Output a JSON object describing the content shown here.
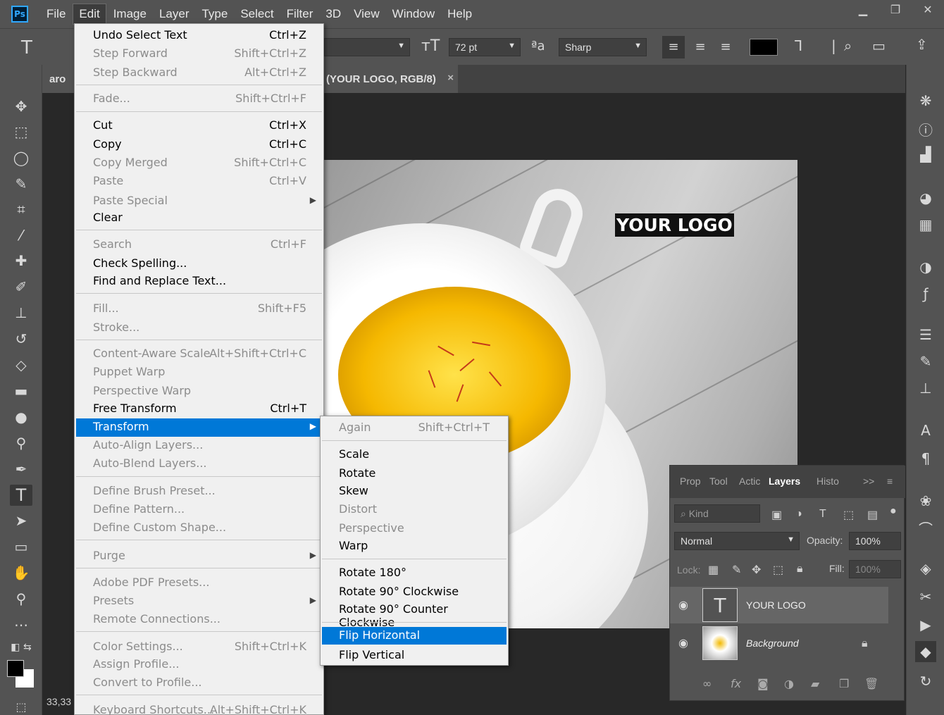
{
  "app": {
    "logo": "Ps"
  },
  "menubar": {
    "items": [
      "File",
      "Edit",
      "Image",
      "Layer",
      "Type",
      "Select",
      "Filter",
      "3D",
      "View",
      "Window",
      "Help"
    ]
  },
  "window_controls": {
    "minimize": "▁",
    "restore": "❐",
    "close": "✕"
  },
  "options": {
    "font_size": "72 pt",
    "antialias_icon_text": "ªa",
    "antialias": "Sharp",
    "text_color": "#000000"
  },
  "document": {
    "tab_left": "aro",
    "tab_active": "(YOUR LOGO, RGB/8)",
    "tab_close": "×",
    "logo_text": "YOUR LOGO"
  },
  "edit_menu": {
    "items": [
      {
        "label": "Undo Select Text",
        "shortcut": "Ctrl+Z",
        "disabled": false
      },
      {
        "label": "Step Forward",
        "shortcut": "Shift+Ctrl+Z",
        "disabled": true
      },
      {
        "label": "Step Backward",
        "shortcut": "Alt+Ctrl+Z",
        "disabled": true
      },
      {
        "label": "Fade...",
        "shortcut": "Shift+Ctrl+F",
        "disabled": true
      },
      {
        "label": "Cut",
        "shortcut": "Ctrl+X",
        "disabled": false
      },
      {
        "label": "Copy",
        "shortcut": "Ctrl+C",
        "disabled": false
      },
      {
        "label": "Copy Merged",
        "shortcut": "Shift+Ctrl+C",
        "disabled": true
      },
      {
        "label": "Paste",
        "shortcut": "Ctrl+V",
        "disabled": true
      },
      {
        "label": "Paste Special",
        "shortcut": "",
        "disabled": true
      },
      {
        "label": "Clear",
        "shortcut": "",
        "disabled": false
      },
      {
        "label": "Search",
        "shortcut": "Ctrl+F",
        "disabled": true
      },
      {
        "label": "Check Spelling...",
        "shortcut": "",
        "disabled": false
      },
      {
        "label": "Find and Replace Text...",
        "shortcut": "",
        "disabled": false
      },
      {
        "label": "Fill...",
        "shortcut": "Shift+F5",
        "disabled": true
      },
      {
        "label": "Stroke...",
        "shortcut": "",
        "disabled": true
      },
      {
        "label": "Content-Aware Scale",
        "shortcut": "Alt+Shift+Ctrl+C",
        "disabled": true
      },
      {
        "label": "Puppet Warp",
        "shortcut": "",
        "disabled": true
      },
      {
        "label": "Perspective Warp",
        "shortcut": "",
        "disabled": true
      },
      {
        "label": "Free Transform",
        "shortcut": "Ctrl+T",
        "disabled": false
      },
      {
        "label": "Transform",
        "shortcut": "",
        "disabled": false
      },
      {
        "label": "Auto-Align Layers...",
        "shortcut": "",
        "disabled": true
      },
      {
        "label": "Auto-Blend Layers...",
        "shortcut": "",
        "disabled": true
      },
      {
        "label": "Define Brush Preset...",
        "shortcut": "",
        "disabled": true
      },
      {
        "label": "Define Pattern...",
        "shortcut": "",
        "disabled": true
      },
      {
        "label": "Define Custom Shape...",
        "shortcut": "",
        "disabled": true
      },
      {
        "label": "Purge",
        "shortcut": "",
        "disabled": true
      },
      {
        "label": "Adobe PDF Presets...",
        "shortcut": "",
        "disabled": true
      },
      {
        "label": "Presets",
        "shortcut": "",
        "disabled": true
      },
      {
        "label": "Remote Connections...",
        "shortcut": "",
        "disabled": true
      },
      {
        "label": "Color Settings...",
        "shortcut": "Shift+Ctrl+K",
        "disabled": true
      },
      {
        "label": "Assign Profile...",
        "shortcut": "",
        "disabled": true
      },
      {
        "label": "Convert to Profile...",
        "shortcut": "",
        "disabled": true
      },
      {
        "label": "Keyboard Shortcuts...",
        "shortcut": "Alt+Shift+Ctrl+K",
        "disabled": true
      }
    ]
  },
  "transform_menu": {
    "items": [
      {
        "label": "Again",
        "shortcut": "Shift+Ctrl+T",
        "disabled": true
      },
      {
        "label": "Scale",
        "shortcut": "",
        "disabled": false
      },
      {
        "label": "Rotate",
        "shortcut": "",
        "disabled": false
      },
      {
        "label": "Skew",
        "shortcut": "",
        "disabled": false
      },
      {
        "label": "Distort",
        "shortcut": "",
        "disabled": true
      },
      {
        "label": "Perspective",
        "shortcut": "",
        "disabled": true
      },
      {
        "label": "Warp",
        "shortcut": "",
        "disabled": false
      },
      {
        "label": "Rotate 180°",
        "shortcut": "",
        "disabled": false
      },
      {
        "label": "Rotate 90° Clockwise",
        "shortcut": "",
        "disabled": false
      },
      {
        "label": "Rotate 90° Counter Clockwise",
        "shortcut": "",
        "disabled": false
      },
      {
        "label": "Flip Horizontal",
        "shortcut": "",
        "disabled": false
      },
      {
        "label": "Flip Vertical",
        "shortcut": "",
        "disabled": false
      }
    ]
  },
  "layers_panel": {
    "tabs": [
      "Prop",
      "Tool",
      "Actic",
      "Layers",
      "Histo"
    ],
    "tabs_overflow": ">>",
    "kind_placeholder": "Kind",
    "blend_mode": "Normal",
    "opacity_label": "Opacity:",
    "opacity": "100%",
    "lock_label": "Lock:",
    "fill_label": "Fill:",
    "fill": "100%",
    "layers": [
      {
        "name": "YOUR LOGO",
        "type": "text",
        "thumb": "T"
      },
      {
        "name": "Background",
        "type": "image",
        "thumb": ""
      }
    ]
  },
  "status": {
    "zoom": "33,33"
  },
  "colors": {
    "accent": "#0078d7",
    "ps_blue": "#31a8ff"
  }
}
